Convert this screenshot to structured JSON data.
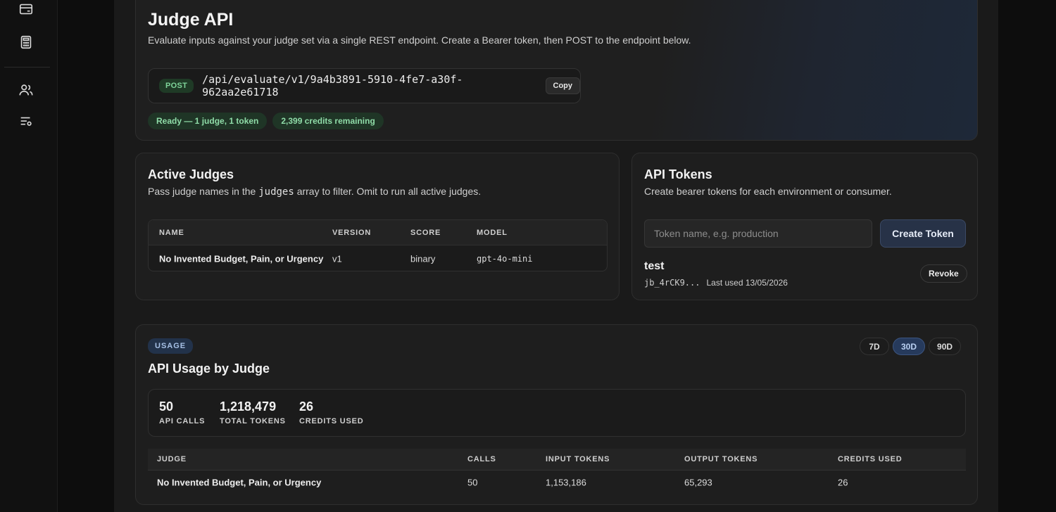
{
  "sidebar": {
    "icons": [
      "card-icon",
      "calculator-icon",
      "users-icon",
      "list-settings-icon"
    ]
  },
  "hero": {
    "title": "Judge API",
    "subtitle": "Evaluate inputs against your judge set via a single REST endpoint. Create a Bearer token, then POST to the endpoint below.",
    "method": "POST",
    "endpoint": "/api/evaluate/v1/9a4b3891-5910-4fe7-a30f-962aa2e61718",
    "copy_label": "Copy",
    "status_ready": "Ready — 1 judge, 1 token",
    "credits_remaining": "2,399 credits remaining"
  },
  "judges": {
    "title": "Active Judges",
    "sub_before": "Pass judge names in the",
    "sub_code": "judges",
    "sub_after": "array to filter. Omit to run all active judges.",
    "columns": [
      "NAME",
      "VERSION",
      "SCORE",
      "MODEL"
    ],
    "rows": [
      {
        "name": "No Invented Budget, Pain, or Urgency",
        "version": "v1",
        "score": "binary",
        "model": "gpt-4o-mini"
      }
    ]
  },
  "tokens": {
    "title": "API Tokens",
    "subtitle": "Create bearer tokens for each environment or consumer.",
    "input_placeholder": "Token name, e.g. production",
    "create_label": "Create Token",
    "items": [
      {
        "name": "test",
        "prefix": "jb_4rCK9...",
        "last_used": "Last used 13/05/2026",
        "revoke_label": "Revoke"
      }
    ]
  },
  "usage": {
    "badge": "USAGE",
    "title": "API Usage by Judge",
    "ranges": [
      "7D",
      "30D",
      "90D"
    ],
    "active_range": "30D",
    "stats": [
      {
        "value": "50",
        "label": "API CALLS"
      },
      {
        "value": "1,218,479",
        "label": "TOTAL TOKENS"
      },
      {
        "value": "26",
        "label": "CREDITS USED"
      }
    ],
    "columns": [
      "JUDGE",
      "CALLS",
      "INPUT TOKENS",
      "OUTPUT TOKENS",
      "CREDITS USED"
    ],
    "rows": [
      {
        "judge": "No Invented Budget, Pain, or Urgency",
        "calls": "50",
        "input_tokens": "1,153,186",
        "output_tokens": "65,293",
        "credits": "26"
      }
    ]
  }
}
